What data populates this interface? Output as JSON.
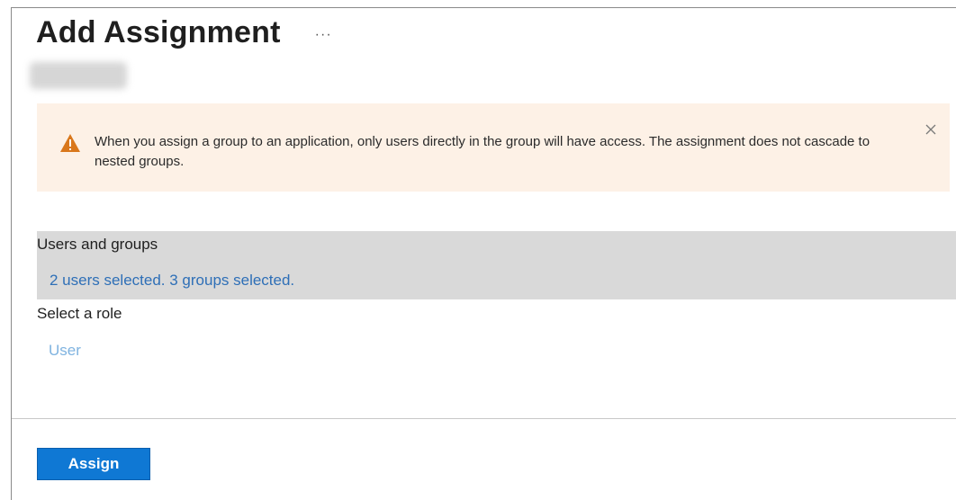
{
  "header": {
    "title": "Add Assignment",
    "more_label": "···"
  },
  "warning": {
    "icon": "warning-triangle-icon",
    "message": "When you assign a group to an application, only users directly in the group will have access. The assignment does not cascade to nested groups.",
    "close_icon": "close-icon",
    "background_color": "#fdf1e6",
    "icon_color": "#d9771b"
  },
  "users_and_groups": {
    "label": "Users and groups",
    "selection_summary": "2 users selected. 3 groups selected."
  },
  "role": {
    "label": "Select a role",
    "value": "User"
  },
  "footer": {
    "assign_label": "Assign"
  },
  "colors": {
    "primary_button": "#0f78d4",
    "link": "#2e6fb7",
    "selected_section_bg": "#d9d9d9"
  }
}
